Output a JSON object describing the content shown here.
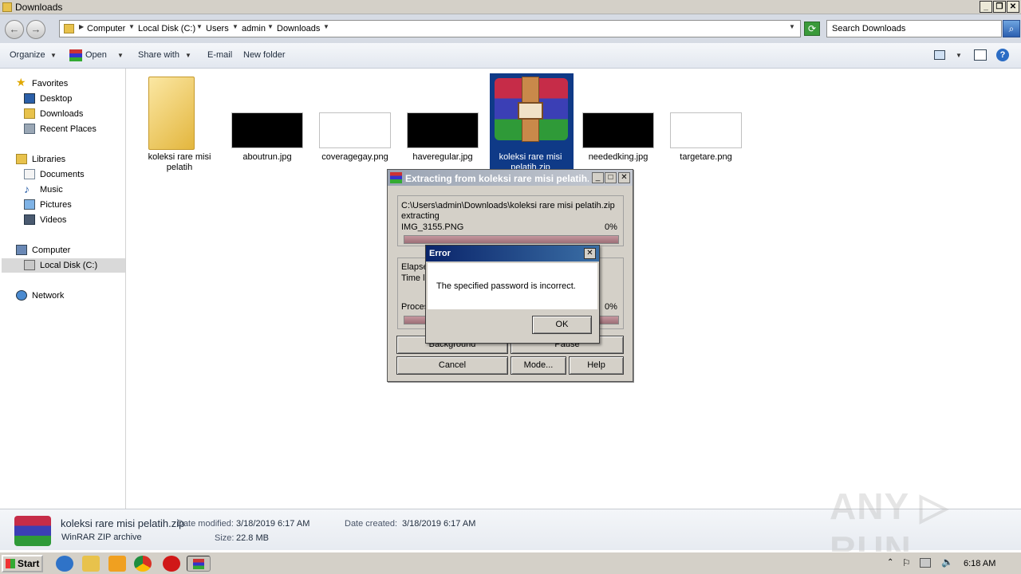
{
  "window": {
    "title": "Downloads"
  },
  "address": {
    "crumbs": [
      "Computer",
      "Local Disk (C:)",
      "Users",
      "admin",
      "Downloads"
    ],
    "search_placeholder": "Search Downloads"
  },
  "toolbar": {
    "organize": "Organize",
    "open": "Open",
    "share_with": "Share with",
    "email": "E-mail",
    "new_folder": "New folder"
  },
  "nav": {
    "favorites": "Favorites",
    "desktop": "Desktop",
    "downloads": "Downloads",
    "recent_places": "Recent Places",
    "libraries": "Libraries",
    "documents": "Documents",
    "music": "Music",
    "pictures": "Pictures",
    "videos": "Videos",
    "computer": "Computer",
    "local_disk": "Local Disk (C:)",
    "network": "Network"
  },
  "files": [
    {
      "name": "koleksi rare misi pelatih",
      "kind": "folder"
    },
    {
      "name": "aboutrun.jpg",
      "kind": "image-dark"
    },
    {
      "name": "coveragegay.png",
      "kind": "image-light"
    },
    {
      "name": "haveregular.jpg",
      "kind": "image-dark"
    },
    {
      "name": "koleksi rare misi pelatih.zip",
      "kind": "winrar"
    },
    {
      "name": "neededking.jpg",
      "kind": "image-dark"
    },
    {
      "name": "targetare.png",
      "kind": "image-light"
    }
  ],
  "details": {
    "file_name": "koleksi rare misi pelatih.zip",
    "type": "WinRAR ZIP archive",
    "date_modified_label": "Date modified:",
    "date_modified": "3/18/2019 6:17 AM",
    "size_label": "Size:",
    "size": "22.8 MB",
    "date_created_label": "Date created:",
    "date_created": "3/18/2019 6:17 AM"
  },
  "extract_dialog": {
    "title": "Extracting from koleksi rare misi pelatih.zip",
    "path": "C:\\Users\\admin\\Downloads\\koleksi rare misi pelatih.zip",
    "status": "extracting",
    "current_file": "IMG_3155.PNG",
    "file_percent": "0%",
    "file_progress": 0,
    "elapsed_label": "Elapsed time",
    "time_left_label": "Time left",
    "processed_label": "Processed",
    "total_percent": "0%",
    "total_progress": 0,
    "background_btn": "Background",
    "pause_btn": "Pause",
    "cancel_btn": "Cancel",
    "mode_btn": "Mode...",
    "help_btn": "Help"
  },
  "error_dialog": {
    "title": "Error",
    "message": "The specified password is incorrect.",
    "ok_btn": "OK"
  },
  "taskbar": {
    "start": "Start",
    "clock": "6:18 AM"
  },
  "watermark": "ANY RUN"
}
